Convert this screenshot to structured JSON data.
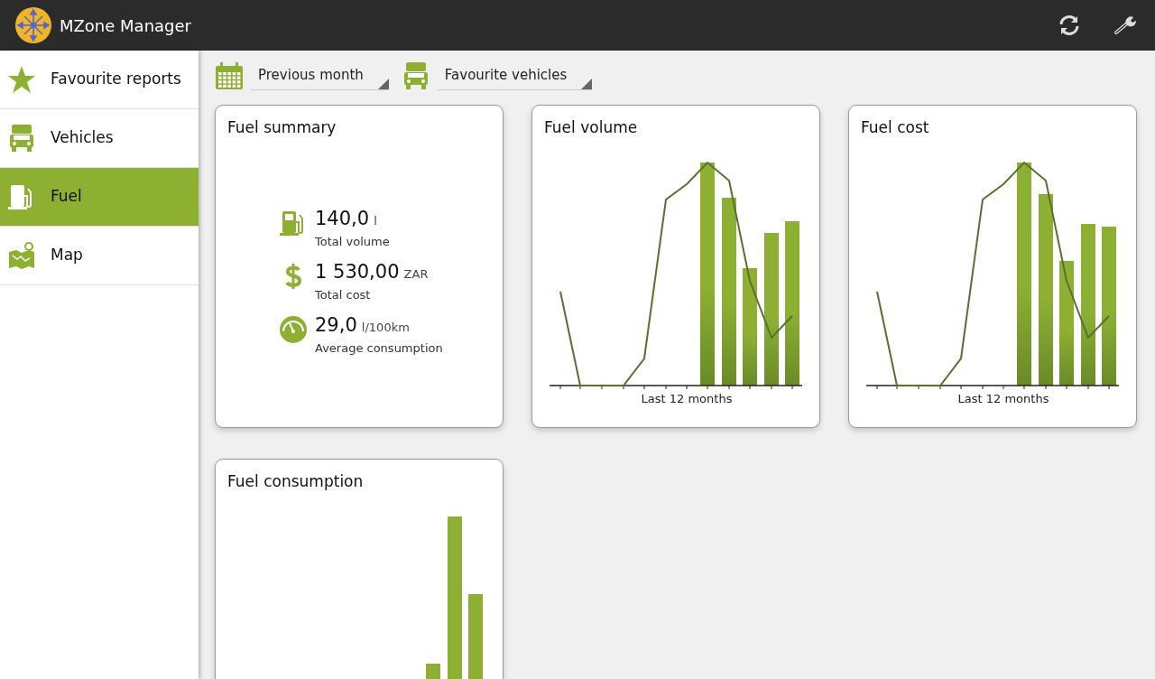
{
  "app": {
    "title": "MZone Manager"
  },
  "sidebar": {
    "items": [
      {
        "kind": "star",
        "label": "Favourite reports",
        "selected": false
      },
      {
        "kind": "truck",
        "label": "Vehicles",
        "selected": false
      },
      {
        "kind": "pump",
        "label": "Fuel",
        "selected": true
      },
      {
        "kind": "map",
        "label": "Map",
        "selected": false
      }
    ]
  },
  "filters": [
    {
      "kind": "calendar",
      "label": "Previous month"
    },
    {
      "kind": "truck",
      "label": "Favourite vehicles"
    }
  ],
  "cards": [
    {
      "kind": "summary",
      "title": "Fuel summary",
      "stats": [
        {
          "kind": "pump",
          "value": "140,0",
          "unit": "l",
          "caption": "Total volume"
        },
        {
          "kind": "dollar",
          "value": "1 530,00",
          "unit": "ZAR",
          "caption": "Total cost"
        },
        {
          "kind": "gauge",
          "value": "29,0",
          "unit": "l/100km",
          "caption": "Average consumption"
        }
      ]
    },
    {
      "kind": "volume",
      "title": "Fuel volume",
      "xlabel": "Last 12 months"
    },
    {
      "kind": "cost",
      "title": "Fuel cost",
      "xlabel": "Last 12 months"
    },
    {
      "kind": "consumption",
      "title": "Fuel consumption"
    }
  ]
}
